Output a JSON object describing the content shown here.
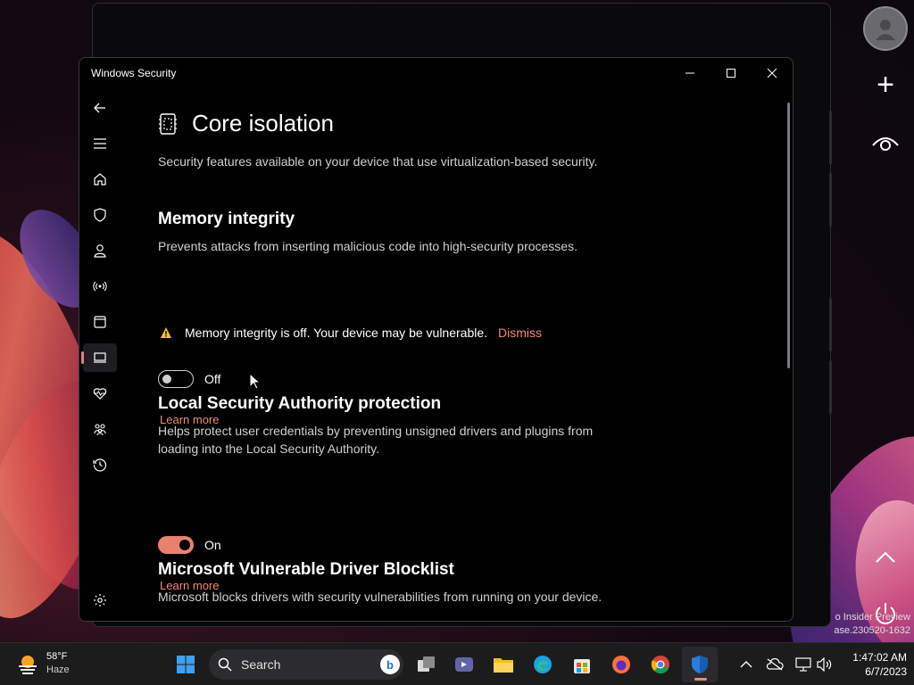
{
  "window": {
    "title": "Windows Security",
    "minimize_label": "Minimize",
    "maximize_label": "Maximize",
    "close_label": "Close"
  },
  "nav": {
    "items": [
      {
        "id": "back",
        "icon": "back-arrow-icon"
      },
      {
        "id": "menu",
        "icon": "hamburger-menu-icon"
      },
      {
        "id": "home",
        "icon": "home-icon"
      },
      {
        "id": "virus",
        "icon": "shield-icon"
      },
      {
        "id": "account",
        "icon": "person-icon"
      },
      {
        "id": "firewall",
        "icon": "wifi-signal-icon"
      },
      {
        "id": "app-browser",
        "icon": "app-window-icon"
      },
      {
        "id": "device-security",
        "icon": "laptop-icon",
        "active": true
      },
      {
        "id": "device-health",
        "icon": "heart-pulse-icon"
      },
      {
        "id": "family",
        "icon": "family-icon"
      },
      {
        "id": "history",
        "icon": "history-icon"
      },
      {
        "id": "settings",
        "icon": "settings-gear-icon"
      }
    ]
  },
  "page": {
    "title": "Core isolation",
    "description": "Security features available on your device that use virtualization-based security.",
    "memory_integrity": {
      "title": "Memory integrity",
      "description": "Prevents attacks from inserting malicious code into high-security processes.",
      "warning": "Memory integrity is off. Your device may be vulnerable.",
      "dismiss": "Dismiss",
      "toggle_state": "Off",
      "learn_more": "Learn more"
    },
    "lsa": {
      "title": "Local Security Authority protection",
      "description": "Helps protect user credentials by preventing unsigned drivers and plugins from loading into the Local Security Authority.",
      "toggle_state": "On",
      "learn_more": "Learn more"
    },
    "blocklist": {
      "title": "Microsoft Vulnerable Driver Blocklist",
      "description": "Microsoft blocks drivers with security vulnerabilities from running on your device."
    }
  },
  "desktop": {
    "watermark_line1": "o Insider Preview",
    "watermark_line2": "ase.230520-1632"
  },
  "taskbar": {
    "weather_temp": "58°F",
    "weather_condition": "Haze",
    "search_placeholder": "Search",
    "apps": [
      "start-icon",
      "task-view-icon",
      "teams-icon",
      "file-explorer-icon",
      "edge-icon",
      "store-icon",
      "firefox-icon",
      "chrome-icon",
      "windows-security-icon"
    ],
    "time": "1:47:02 AM",
    "date": "6/7/2023"
  },
  "colors": {
    "accent": "#e8826e",
    "window_bg": "#000000",
    "taskbar_bg": "#1c1c1c"
  }
}
